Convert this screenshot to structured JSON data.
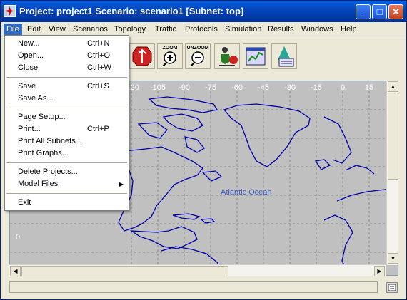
{
  "window": {
    "title": "Project: project1 Scenario: scenario1  [Subnet: top]",
    "controls": {
      "minimize": "_",
      "maximize": "□",
      "close": "✕"
    }
  },
  "menubar": {
    "items": [
      "File",
      "Edit",
      "View",
      "Scenarios",
      "Topology",
      "Traffic",
      "Protocols",
      "Simulation",
      "Results",
      "Windows",
      "Help"
    ],
    "active": "File"
  },
  "file_menu": {
    "groups": [
      [
        {
          "label": "New...",
          "shortcut": "Ctrl+N"
        },
        {
          "label": "Open...",
          "shortcut": "Ctrl+O"
        },
        {
          "label": "Close",
          "shortcut": "Ctrl+W"
        }
      ],
      [
        {
          "label": "Save",
          "shortcut": "Ctrl+S"
        },
        {
          "label": "Save As...",
          "shortcut": ""
        }
      ],
      [
        {
          "label": "Page Setup...",
          "shortcut": ""
        },
        {
          "label": "Print...",
          "shortcut": "Ctrl+P"
        },
        {
          "label": "Print All Subnets...",
          "shortcut": ""
        },
        {
          "label": "Print Graphs...",
          "shortcut": ""
        }
      ],
      [
        {
          "label": "Delete Projects...",
          "shortcut": ""
        },
        {
          "label": "Model Files",
          "shortcut": "",
          "submenu": true
        }
      ],
      [
        {
          "label": "Exit",
          "shortcut": ""
        }
      ]
    ]
  },
  "toolbar": {
    "zoom_label": "ZOOM",
    "unzoom_label": "UNZOOM",
    "icons": [
      "node-icon",
      "zoom-in-icon",
      "zoom-out-icon",
      "configure-sim-icon",
      "view-results-icon",
      "view-graphs-icon"
    ]
  },
  "map": {
    "longitude_ticks": [
      "-120",
      "-105",
      "-90",
      "-75",
      "-60",
      "-45",
      "-30",
      "-15",
      "0",
      "15"
    ],
    "latitude_tick": "0",
    "ocean_label": "Atlantic Ocean",
    "colors": {
      "background": "#c0c0c0",
      "coastline": "#0000aa",
      "grid": "#8a8a8a",
      "label": "#3a5fd0"
    }
  },
  "scrollbars": {
    "up": "▲",
    "down": "▼",
    "left": "◀",
    "right": "▶"
  },
  "status": {
    "text": ""
  }
}
